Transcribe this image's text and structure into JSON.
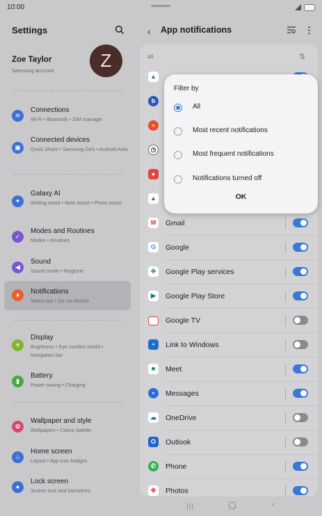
{
  "status": {
    "time": "10:00"
  },
  "settings": {
    "title": "Settings",
    "profile": {
      "name": "Zoe Taylor",
      "subtitle": "Samsung account",
      "avatar_letter": "Z"
    },
    "items": [
      {
        "label": "Connections",
        "sub": "Wi-Fi  •  Bluetooth  •  SIM manager",
        "icon": "wifi-icon",
        "color": "#3d6fd6"
      },
      {
        "label": "Connected devices",
        "sub": "Quick Share  •  Samsung DeX  •  Android Auto",
        "icon": "connected-devices-icon",
        "color": "#3d6fd6"
      },
      {
        "label": "Galaxy AI",
        "sub": "Writing assist  •  Note assist  •  Photo assist",
        "icon": "galaxy-ai-icon",
        "color": "#3d6fd6"
      },
      {
        "label": "Modes and Routines",
        "sub": "Modes  •  Routines",
        "icon": "modes-icon",
        "color": "#7a57d1"
      },
      {
        "label": "Sound",
        "sub": "Sound mode  •  Ringtone",
        "icon": "sound-icon",
        "color": "#7a57d1"
      },
      {
        "label": "Notifications",
        "sub": "Status bar  •  Do not disturb",
        "icon": "notifications-icon",
        "color": "#e5612f"
      },
      {
        "label": "Display",
        "sub": "Brightness  •  Eye comfort shield  •  Navigation bar",
        "icon": "display-icon",
        "color": "#7fb52b"
      },
      {
        "label": "Battery",
        "sub": "Power saving  •  Charging",
        "icon": "battery-icon",
        "color": "#4aa842"
      },
      {
        "label": "Wallpaper and style",
        "sub": "Wallpapers  •  Colour palette",
        "icon": "wallpaper-icon",
        "color": "#d8486e"
      },
      {
        "label": "Home screen",
        "sub": "Layout  •  App icon badges",
        "icon": "home-screen-icon",
        "color": "#3d6fd6"
      },
      {
        "label": "Lock screen",
        "sub": "Screen lock and biometrics",
        "icon": "lock-icon",
        "color": "#3d6fd6"
      }
    ]
  },
  "notifications": {
    "title": "App notifications",
    "filter_label": "All",
    "apps": [
      {
        "name": "Gmail",
        "on": true,
        "color": "#ffffff"
      },
      {
        "name": "Google",
        "on": true,
        "color": "#ffffff"
      },
      {
        "name": "Google Play services",
        "on": true,
        "color": "#ffffff"
      },
      {
        "name": "Google Play Store",
        "on": true,
        "color": "#ffffff"
      },
      {
        "name": "Google TV",
        "on": false,
        "color": "#ffffff"
      },
      {
        "name": "Link to Windows",
        "on": false,
        "color": "#1d6fc6"
      },
      {
        "name": "Meet",
        "on": true,
        "color": "#ffffff"
      },
      {
        "name": "Messages",
        "on": true,
        "color": "#2b6fd6"
      },
      {
        "name": "OneDrive",
        "on": false,
        "color": "#ffffff"
      },
      {
        "name": "Outlook",
        "on": false,
        "color": "#1f64c6"
      },
      {
        "name": "Phone",
        "on": true,
        "color": "#2fb050"
      },
      {
        "name": "Photos",
        "on": true,
        "color": "#ffffff"
      }
    ]
  },
  "popup": {
    "title": "Filter by",
    "options": [
      {
        "label": "All",
        "selected": true
      },
      {
        "label": "Most recent notifications",
        "selected": false
      },
      {
        "label": "Most frequent notifications",
        "selected": false
      },
      {
        "label": "Notifications turned off",
        "selected": false
      }
    ],
    "ok_label": "OK"
  }
}
